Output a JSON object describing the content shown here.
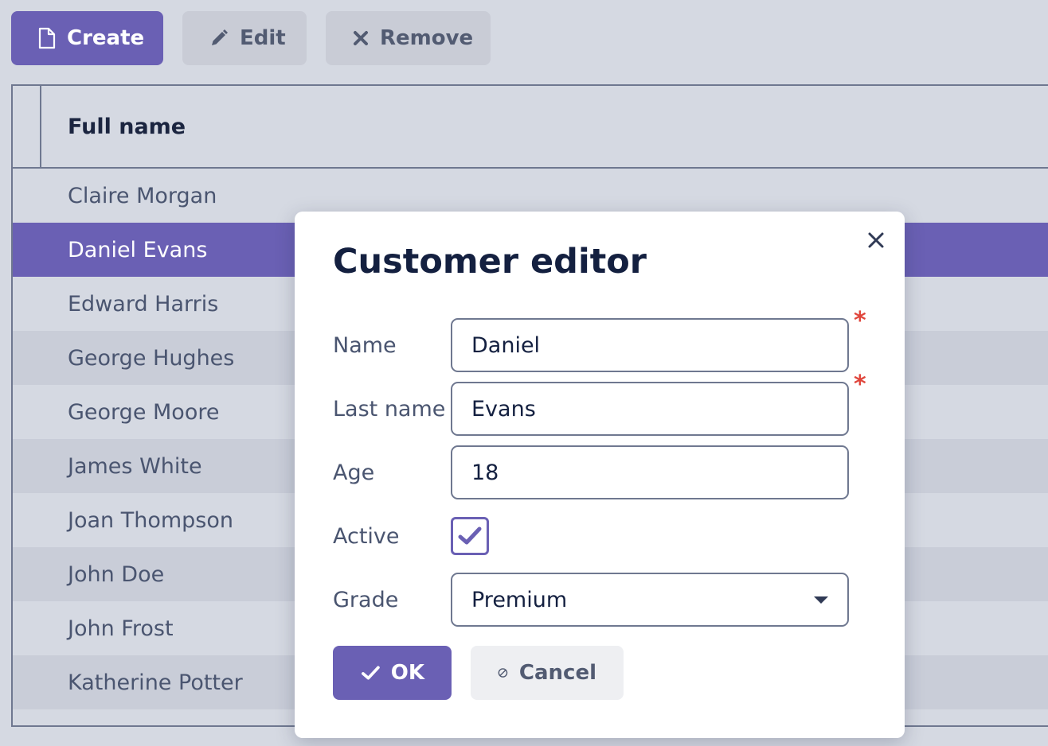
{
  "toolbar": {
    "create_label": "Create",
    "edit_label": "Edit",
    "remove_label": "Remove"
  },
  "grid": {
    "column_header": "Full name",
    "rows": [
      "Claire Morgan",
      "Daniel Evans",
      "Edward Harris",
      "George Hughes",
      "George Moore",
      "James White",
      "Joan Thompson",
      "John Doe",
      "John Frost",
      "Katherine Potter"
    ],
    "selected_row": "Daniel Evans"
  },
  "dialog": {
    "title": "Customer editor",
    "fields": {
      "name": {
        "label": "Name",
        "value": "Daniel",
        "required_mark": "*"
      },
      "last_name": {
        "label": "Last name",
        "value": "Evans",
        "required_mark": "*"
      },
      "age": {
        "label": "Age",
        "value": "18"
      },
      "active": {
        "label": "Active",
        "checked": true
      },
      "grade": {
        "label": "Grade",
        "value": "Premium"
      }
    },
    "ok_label": "OK",
    "cancel_label": "Cancel"
  },
  "colors": {
    "accent": "#6a60b4",
    "background": "#d5d9e2",
    "required": "#e0463c"
  },
  "icons": [
    "file-icon",
    "pencil-icon",
    "x-icon",
    "close-icon",
    "check-icon",
    "ban-icon",
    "chevron-down-icon"
  ]
}
